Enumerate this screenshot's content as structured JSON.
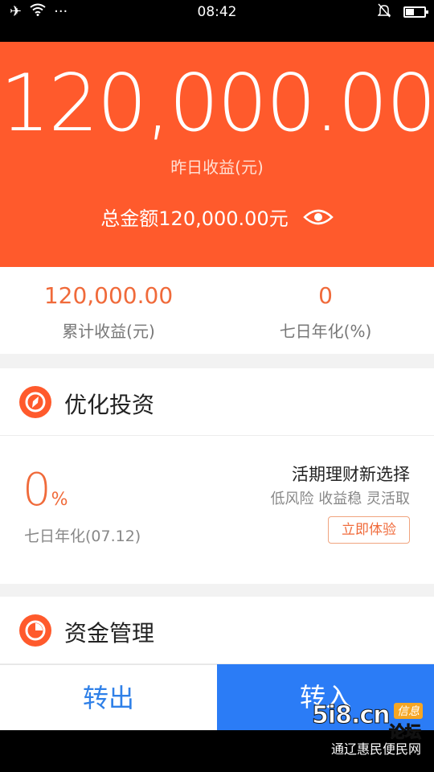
{
  "status_bar": {
    "time": "08:42",
    "more": "···"
  },
  "hero": {
    "yesterday_earnings": "120,000.00",
    "yesterday_label": "昨日收益(元)",
    "total_label": "总金额120,000.00元"
  },
  "stats": {
    "cumulative_value": "120,000.00",
    "cumulative_label": "累计收益(元)",
    "seven_day_value": "0",
    "seven_day_label": "七日年化(%)"
  },
  "invest": {
    "title": "优化投资",
    "rate_value": "0",
    "rate_unit": "%",
    "rate_label": "七日年化(07.12)",
    "promo_title": "活期理财新选择",
    "promo_sub": "低风险 收益稳 灵活取",
    "try_button": "立即体验"
  },
  "funds": {
    "title": "资金管理"
  },
  "bottom": {
    "transfer_out": "转出",
    "transfer_in": "转入"
  },
  "watermark": {
    "line1": "5i8.cn",
    "badge": "信息",
    "word": "论坛",
    "line2": "通辽惠民便民网"
  },
  "colors": {
    "hero": "#ff5a2c",
    "accent": "#f06a3a",
    "blue": "#2b7cf6"
  },
  "icons": [
    "airplane-icon",
    "wifi-icon",
    "bell-mute-icon",
    "battery-icon",
    "eye-icon",
    "compass-icon",
    "pie-chart-icon"
  ]
}
